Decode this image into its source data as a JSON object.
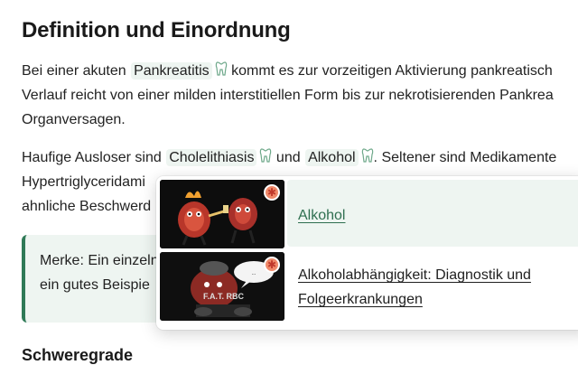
{
  "article": {
    "heading_definition": "Definition und Einordnung",
    "p1": {
      "before": "Bei einer akuten ",
      "term": "Pankreatitis",
      "after": " kommt es zur vorzeitigen Aktivierung pankreatisch",
      "line2": "Verlauf reicht von einer milden interstitiellen Form bis zur nekrotisierenden Pankrea",
      "line3": "Organversagen."
    },
    "p2": {
      "before": "Haufige Ausloser sind ",
      "term1": "Cholelithiasis",
      "mid": " und ",
      "term2": "Alkohol",
      "after": ". Seltener sind Medikamente",
      "line2": "Hypertriglyceridami",
      "line3": "ahnliche Beschwerd"
    },
    "callout": {
      "line1": "Merke: Ein einzeln",
      "line2": "ein gutes Beispie"
    },
    "heading_severity": "Schweregrade"
  },
  "popup": {
    "results": [
      {
        "title": "Alkohol"
      },
      {
        "title_line1": "Alkoholabhängigkeit: Diagnostik und",
        "title_line2": "Folgeerkrankungen",
        "thumb_text": "F.A.T. RBC"
      }
    ],
    "badge_symbol": "✱",
    "close_symbol": "×"
  },
  "colors": {
    "accent": "#2f7a57",
    "highlight_bg": "#eef5f1"
  }
}
